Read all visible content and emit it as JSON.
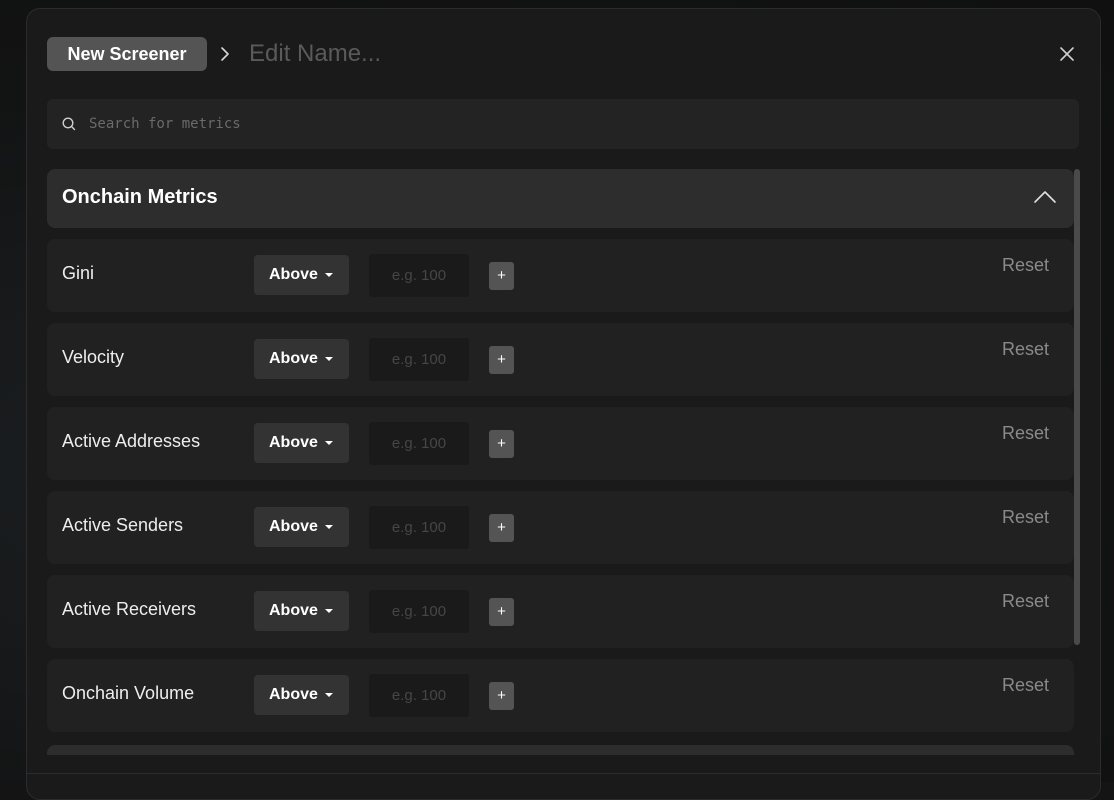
{
  "header": {
    "breadcrumb_label": "New Screener",
    "name_placeholder": "Edit Name..."
  },
  "search": {
    "placeholder": "Search for metrics"
  },
  "section": {
    "title": "Onchain Metrics"
  },
  "rows": [
    {
      "label": "Gini",
      "operator": "Above",
      "value_placeholder": "e.g. 100",
      "add_label": "+",
      "reset_label": "Reset"
    },
    {
      "label": "Velocity",
      "operator": "Above",
      "value_placeholder": "e.g. 100",
      "add_label": "+",
      "reset_label": "Reset"
    },
    {
      "label": "Active Addresses",
      "operator": "Above",
      "value_placeholder": "e.g. 100",
      "add_label": "+",
      "reset_label": "Reset"
    },
    {
      "label": "Active Senders",
      "operator": "Above",
      "value_placeholder": "e.g. 100",
      "add_label": "+",
      "reset_label": "Reset"
    },
    {
      "label": "Active Receivers",
      "operator": "Above",
      "value_placeholder": "e.g. 100",
      "add_label": "+",
      "reset_label": "Reset"
    },
    {
      "label": "Onchain Volume",
      "operator": "Above",
      "value_placeholder": "e.g. 100",
      "add_label": "+",
      "reset_label": "Reset"
    }
  ],
  "icons": {
    "breadcrumb_separator": "chevron-right-icon",
    "close": "close-icon",
    "search": "search-icon",
    "collapse": "chevron-up-icon",
    "operator_caret": "caret-down-icon"
  },
  "colors": {
    "background": "#141414",
    "modal": "#1a1a1a",
    "row": "#212121",
    "section_header": "#2d2d2d",
    "button": "#545454",
    "muted_text": "#8a8a8a"
  }
}
